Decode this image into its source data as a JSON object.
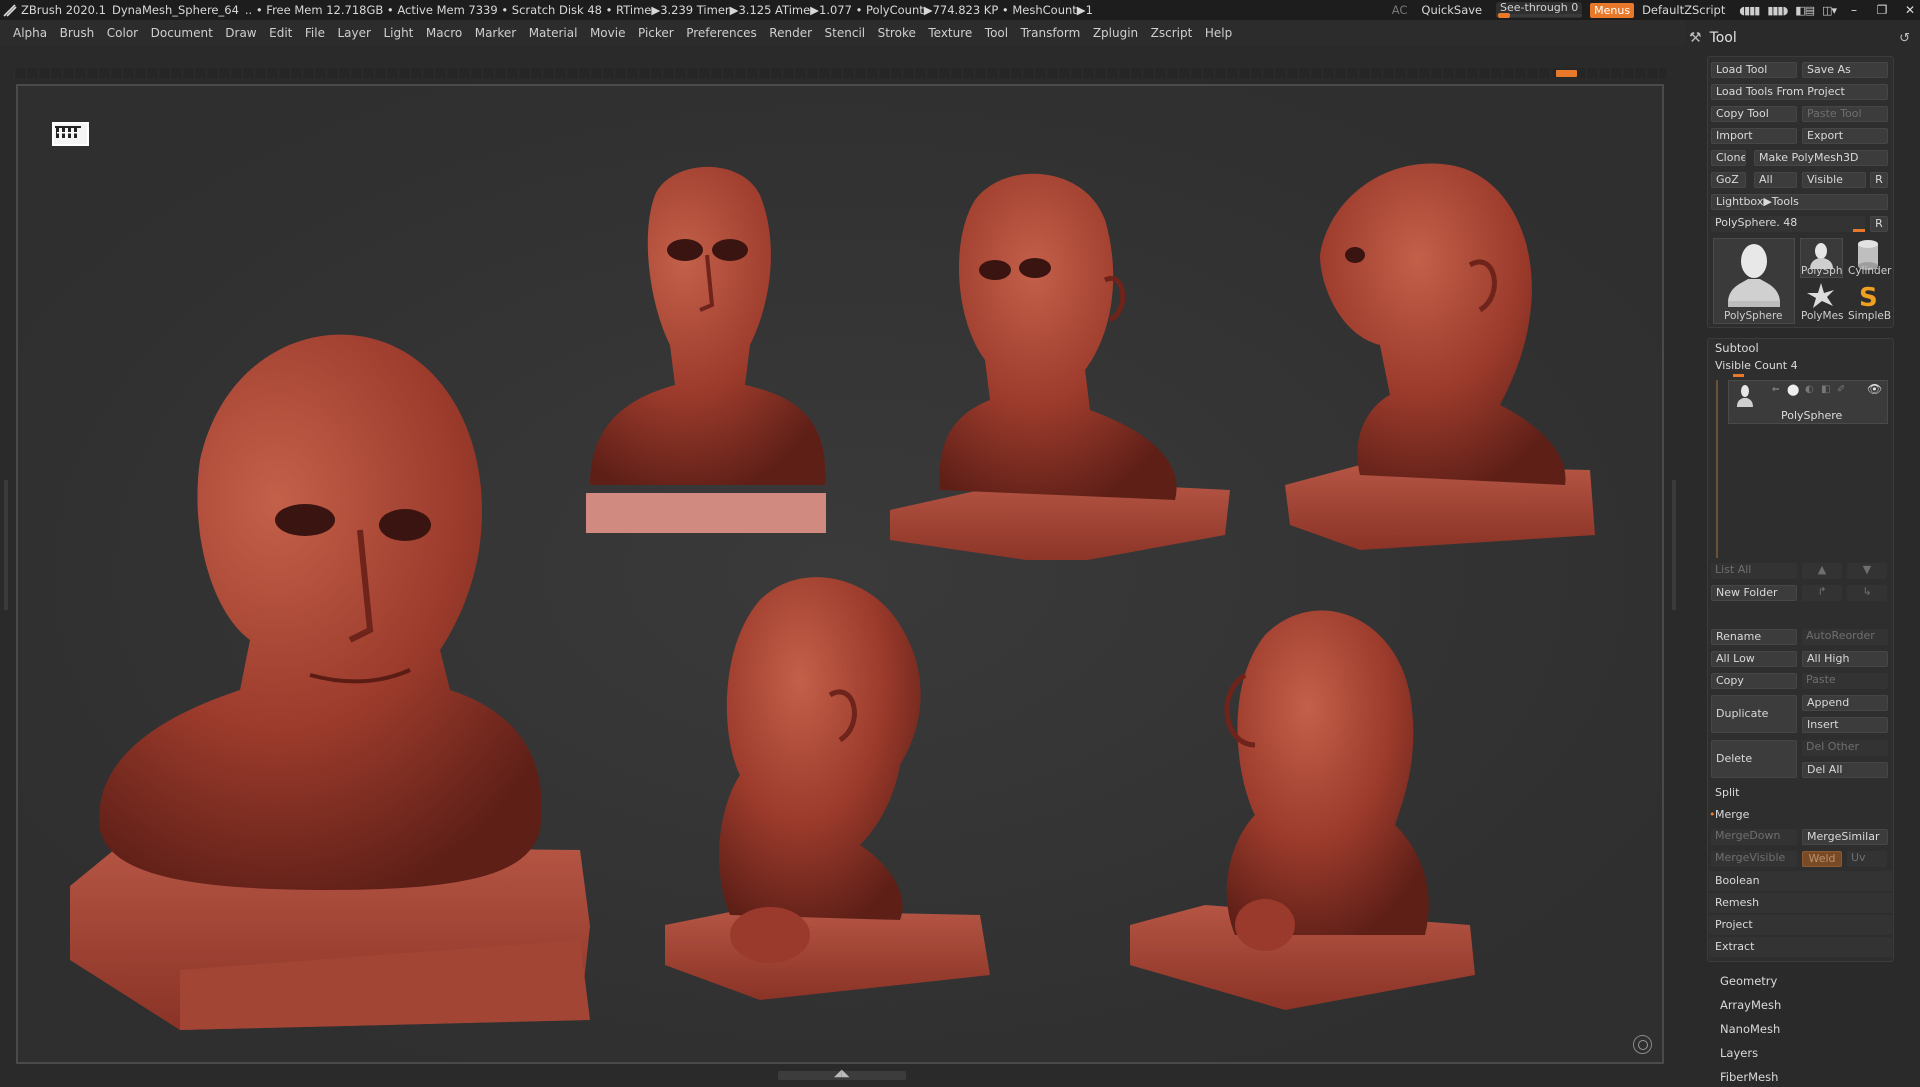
{
  "titlebar": {
    "app": "ZBrush 2020.1",
    "document": "DynaMesh_Sphere_64",
    "stats": ".. • Free Mem 12.718GB • Active Mem 7339 • Scratch Disk 48 •  RTime▶3.239 Timer▶3.125 ATime▶1.077 • PolyCount▶774.823 KP  • MeshCount▶1",
    "ac": "AC",
    "quicksave": "QuickSave",
    "see_through_label": "See-through",
    "see_through_value": "0",
    "see_through_level": 0.0,
    "menus": "Menus",
    "script": "DefaultZScript"
  },
  "menubar": [
    "Alpha",
    "Brush",
    "Color",
    "Document",
    "Draw",
    "Edit",
    "File",
    "Layer",
    "Light",
    "Macro",
    "Marker",
    "Material",
    "Movie",
    "Picker",
    "Preferences",
    "Render",
    "Stencil",
    "Stroke",
    "Texture",
    "Tool",
    "Transform",
    "Zplugin",
    "Zscript",
    "Help"
  ],
  "tool": {
    "title": "Tool",
    "load_tool": "Load Tool",
    "save_as": "Save As",
    "load_from_project": "Load Tools From Project",
    "copy_tool": "Copy Tool",
    "paste_tool": "Paste Tool",
    "import": "Import",
    "export": "Export",
    "clone": "Clone",
    "make_polymesh": "Make PolyMesh3D",
    "goz": "GoZ",
    "all": "All",
    "visible": "Visible",
    "r": "R",
    "lightbox_tools": "Lightbox▶Tools",
    "polysphere_slider": "PolySphere. 48",
    "thumbs": {
      "main": "PolySphere",
      "small1": "PolySph",
      "small2": "Cylinder",
      "small3": "PolyMes",
      "small4": "SimpleB"
    }
  },
  "subtool": {
    "title": "Subtool",
    "visible_count": "Visible Count 4",
    "item_name": "PolySphere",
    "list_all": "List All",
    "new_folder": "New Folder",
    "rename": "Rename",
    "auto_reorder": "AutoReorder",
    "all_low": "All Low",
    "all_high": "All High",
    "copy": "Copy",
    "paste": "Paste",
    "duplicate": "Duplicate",
    "append": "Append",
    "insert": "Insert",
    "delete": "Delete",
    "del_other": "Del Other",
    "del_all": "Del All",
    "split": "Split",
    "merge": "Merge",
    "merge_down": "MergeDown",
    "merge_similar": "MergeSimilar",
    "merge_visible": "MergeVisible",
    "weld": "Weld",
    "uv": "Uv",
    "boolean": "Boolean",
    "remesh": "Remesh",
    "project": "Project",
    "extract": "Extract"
  },
  "sections": [
    "Geometry",
    "ArrayMesh",
    "NanoMesh",
    "Layers",
    "FiberMesh"
  ],
  "colors": {
    "accent": "#e8782a",
    "clay": "#9a3a2c",
    "background": "#2a2a2a"
  }
}
